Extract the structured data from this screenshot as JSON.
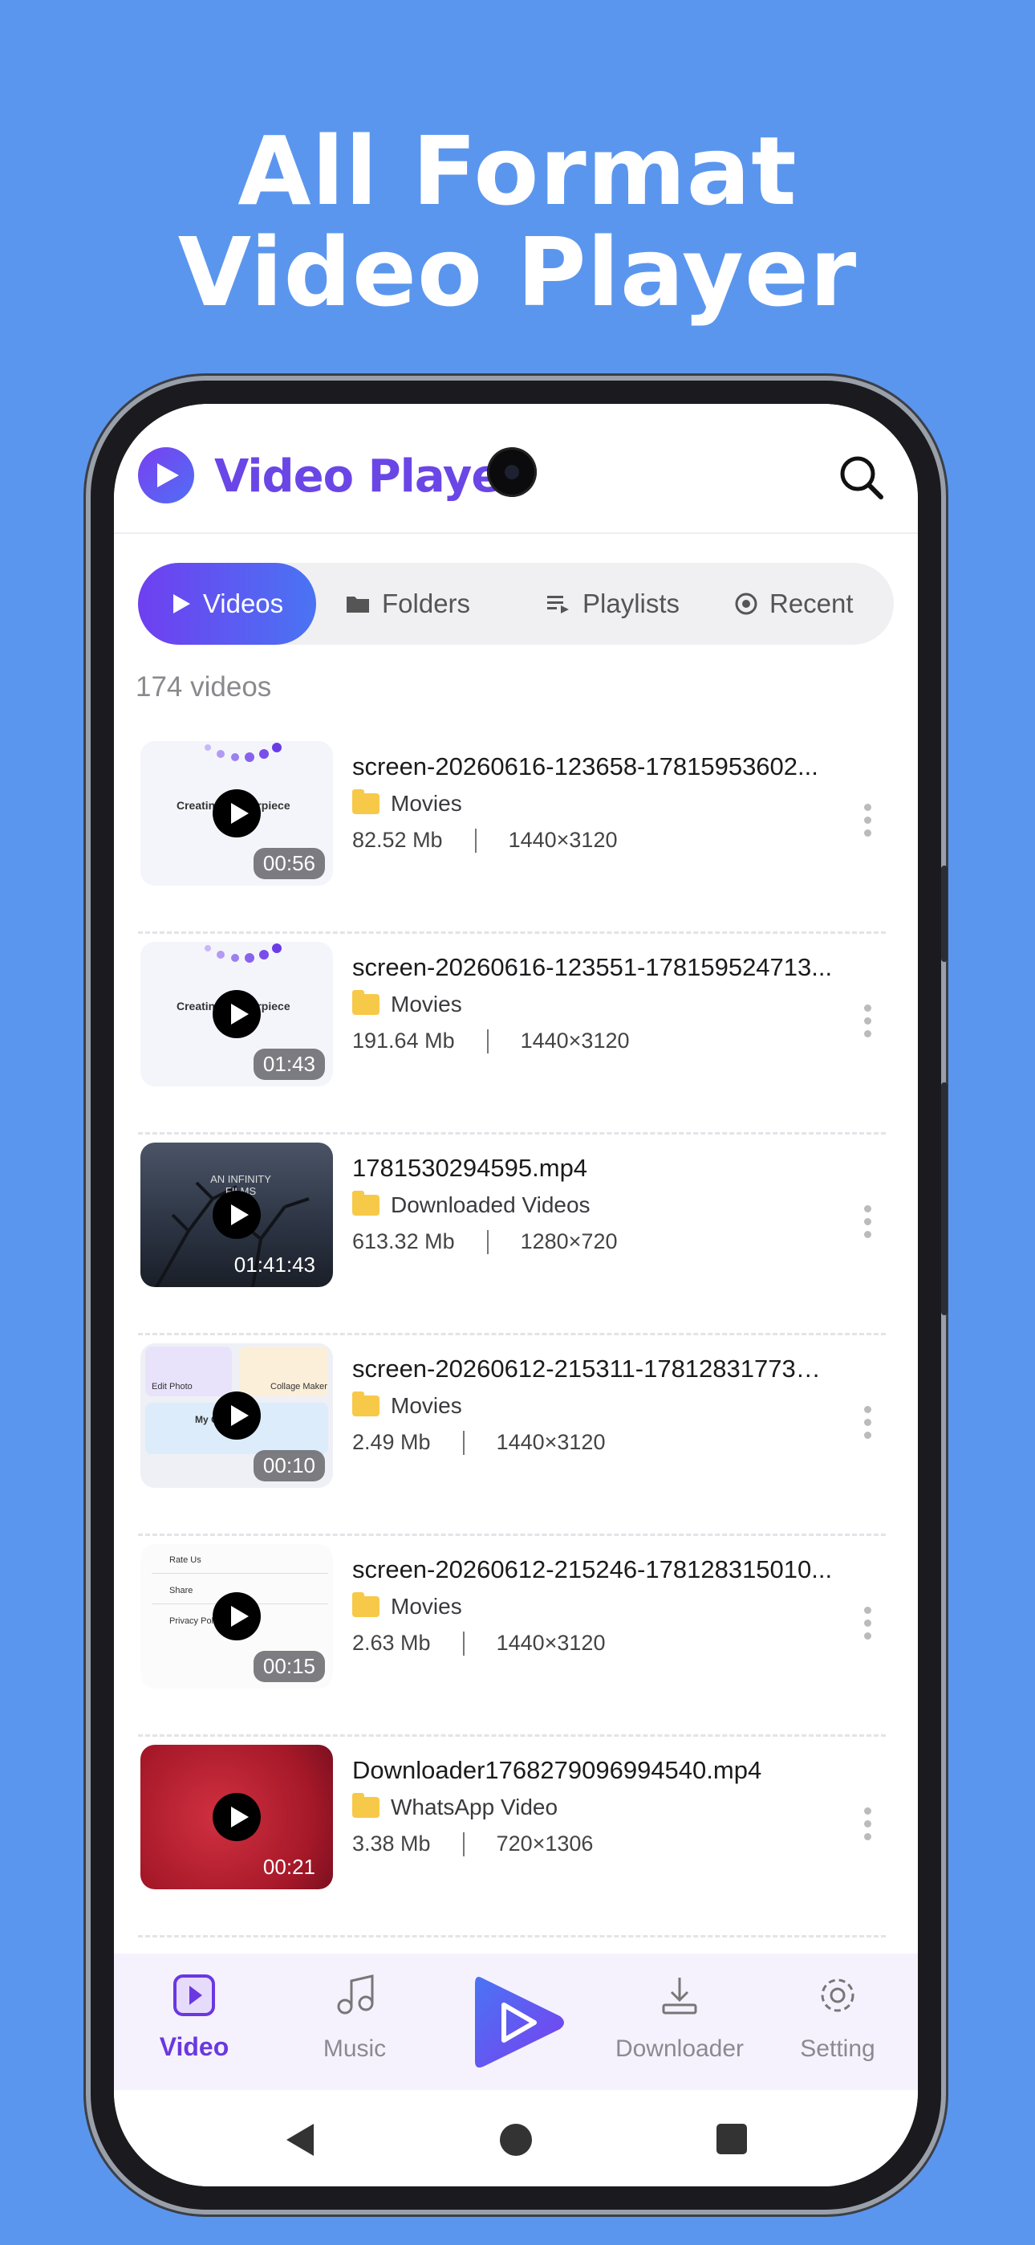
{
  "headline": {
    "line1": "All Format",
    "line2": "Video Player"
  },
  "appbar": {
    "title": "Video Player",
    "logo_icon": "play-circle-icon",
    "search_icon": "search-icon"
  },
  "tabs": [
    {
      "label": "Videos",
      "icon": "play-icon",
      "active": true
    },
    {
      "label": "Folders",
      "icon": "folder-icon",
      "active": false
    },
    {
      "label": "Playlists",
      "icon": "playlist-icon",
      "active": false
    },
    {
      "label": "Recent",
      "icon": "history-icon",
      "active": false
    }
  ],
  "video_count": "174 videos",
  "videos": [
    {
      "name": "screen-20260616-123658-17815953602...",
      "folder": "Movies",
      "size": "82.52 Mb",
      "resolution": "1440×3120",
      "duration": "00:56",
      "thumb": "light"
    },
    {
      "name": "screen-20260616-123551-178159524713...",
      "folder": "Movies",
      "size": "191.64 Mb",
      "resolution": "1440×3120",
      "duration": "01:43",
      "thumb": "light"
    },
    {
      "name": "1781530294595.mp4",
      "folder": "Downloaded Videos",
      "size": "613.32 Mb",
      "resolution": "1280×720",
      "duration": "01:41:43",
      "thumb": "dark"
    },
    {
      "name": "screen-20260612-215311-1781283177321....",
      "folder": "Movies",
      "size": "2.49 Mb",
      "resolution": "1440×3120",
      "duration": "00:10",
      "thumb": "grid"
    },
    {
      "name": "screen-20260612-215246-178128315010...",
      "folder": "Movies",
      "size": "2.63 Mb",
      "resolution": "1440×3120",
      "duration": "00:15",
      "thumb": "list"
    },
    {
      "name": "Downloader1768279096994540.mp4",
      "folder": "WhatsApp Video",
      "size": "3.38 Mb",
      "resolution": "720×1306",
      "duration": "00:21",
      "thumb": "red"
    }
  ],
  "thumb_text": {
    "light_title": "Creating Masterpiece",
    "grid_edit": "Edit Photo",
    "grid_collage": "Collage Maker",
    "grid_my": "My C",
    "list_rate": "Rate Us",
    "list_share": "Share",
    "list_privacy": "Privacy Poli",
    "dark_text": "AN INFINITY FILMS"
  },
  "bottom_nav": [
    {
      "label": "Video",
      "icon": "video-icon",
      "active": true
    },
    {
      "label": "Music",
      "icon": "music-note-icon",
      "active": false
    },
    {
      "label": "",
      "icon": "player-center-icon",
      "active": false
    },
    {
      "label": "Downloader",
      "icon": "download-icon",
      "active": false
    },
    {
      "label": "Setting",
      "icon": "gear-icon",
      "active": false
    }
  ],
  "colors": {
    "background": "#5B96EE",
    "accent": "#6A46E6",
    "accent2": "#4A74F3"
  }
}
